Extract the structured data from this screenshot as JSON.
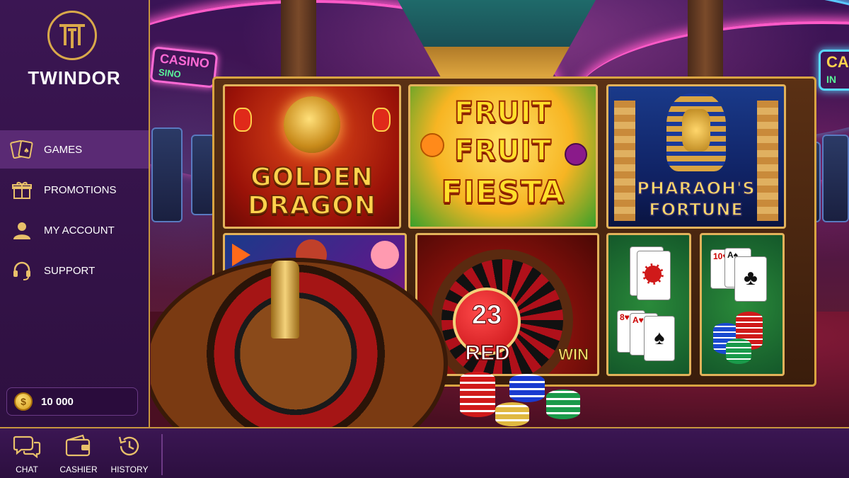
{
  "brand": {
    "name": "TWINDOR"
  },
  "nav": {
    "items": [
      {
        "label": "GAMES",
        "icon": "cards-icon",
        "active": true
      },
      {
        "label": "PROMOTIONS",
        "icon": "gift-icon",
        "active": false
      },
      {
        "label": "MY ACCOUNT",
        "icon": "user-icon",
        "active": false
      },
      {
        "label": "SUPPORT",
        "icon": "headset-icon",
        "active": false
      }
    ]
  },
  "balance": {
    "amount": "10 000",
    "icon": "coin-icon"
  },
  "bottom_bar": {
    "buttons": [
      {
        "label": "CHAT",
        "icon": "chat-icon"
      },
      {
        "label": "CASHIER",
        "icon": "wallet-icon"
      },
      {
        "label": "HISTORY",
        "icon": "history-icon"
      }
    ]
  },
  "games": {
    "golden_dragon": {
      "line1": "GOLDEN",
      "line2": "DRAGON"
    },
    "fruit_fiesta": {
      "line1": "FRUIT",
      "line2": "FRUIT",
      "line3": "FIESTA"
    },
    "pharaoh": {
      "line1": "PHARAOH'S",
      "line2": "FORTUNE"
    },
    "roulette_result": {
      "number": "23",
      "color": "RED",
      "status": "WIN"
    }
  },
  "signage": {
    "left_sign": "CASINO",
    "left_sign_sub": "SINO",
    "right_sign": "CASI",
    "right_sign_sub": "IN"
  },
  "colors": {
    "accent_gold": "#d9a441",
    "sidebar_bg": "#3b1653",
    "active_nav_bg": "#5a2a74",
    "win_red": "#d8161e"
  }
}
